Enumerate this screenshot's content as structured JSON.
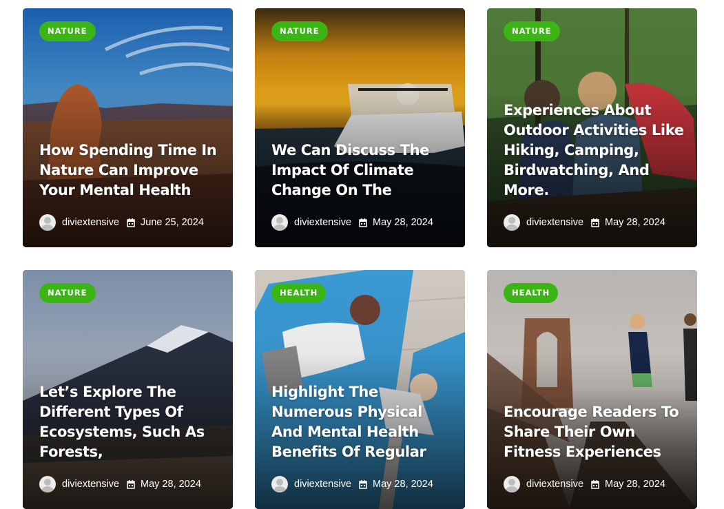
{
  "posts": [
    {
      "category": "NATURE",
      "title": "How Spending Time In Nature Can Improve Your Mental Health",
      "author": "diviextensive",
      "date": "June 25, 2024"
    },
    {
      "category": "NATURE",
      "title": "We Can Discuss The Impact Of Climate Change On The",
      "author": "diviextensive",
      "date": "May 28, 2024"
    },
    {
      "category": "NATURE",
      "title": "Experiences About Outdoor Activities Like Hiking, Camping, Birdwatching, And More.",
      "author": "diviextensive",
      "date": "May 28, 2024"
    },
    {
      "category": "NATURE",
      "title": "Let’s Explore The Different Types Of Ecosystems, Such As Forests,",
      "author": "diviextensive",
      "date": "May 28, 2024"
    },
    {
      "category": "HEALTH",
      "title": "Highlight The Numerous Physical And Mental Health Benefits Of Regular",
      "author": "diviextensive",
      "date": "May 28, 2024"
    },
    {
      "category": "HEALTH",
      "title": "Encourage Readers To Share Their Own Fitness Experiences",
      "author": "diviextensive",
      "date": "May 28, 2024"
    }
  ],
  "colors": {
    "badge": "#3bb513",
    "text": "#ffffff"
  },
  "icons": {
    "avatar": "user-avatar-icon",
    "date": "calendar-icon"
  }
}
